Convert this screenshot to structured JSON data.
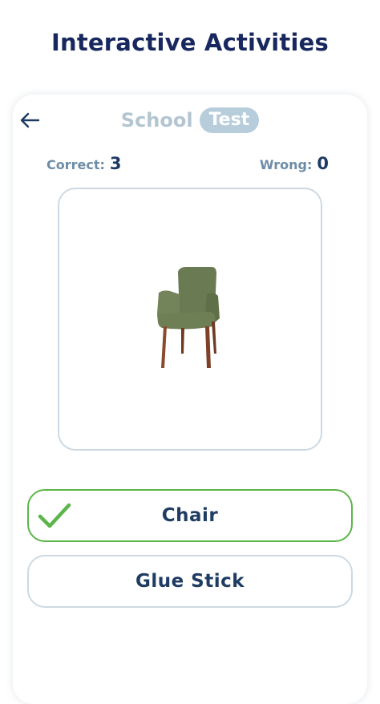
{
  "page_title": "Interactive Activities",
  "header": {
    "category": "School",
    "mode": "Test"
  },
  "score": {
    "correct_label": "Correct:",
    "correct_value": "3",
    "wrong_label": "Wrong:",
    "wrong_value": "0"
  },
  "question": {
    "image_icon": "chair-image"
  },
  "options": [
    {
      "label": "Chair",
      "state": "correct",
      "icon": "checkmark-icon"
    },
    {
      "label": "Glue Stick",
      "state": "default"
    }
  ],
  "colors": {
    "title": "#18285e",
    "accent_correct": "#5cb54a",
    "badge": "#b7cddb",
    "border": "#cdd9e2"
  }
}
